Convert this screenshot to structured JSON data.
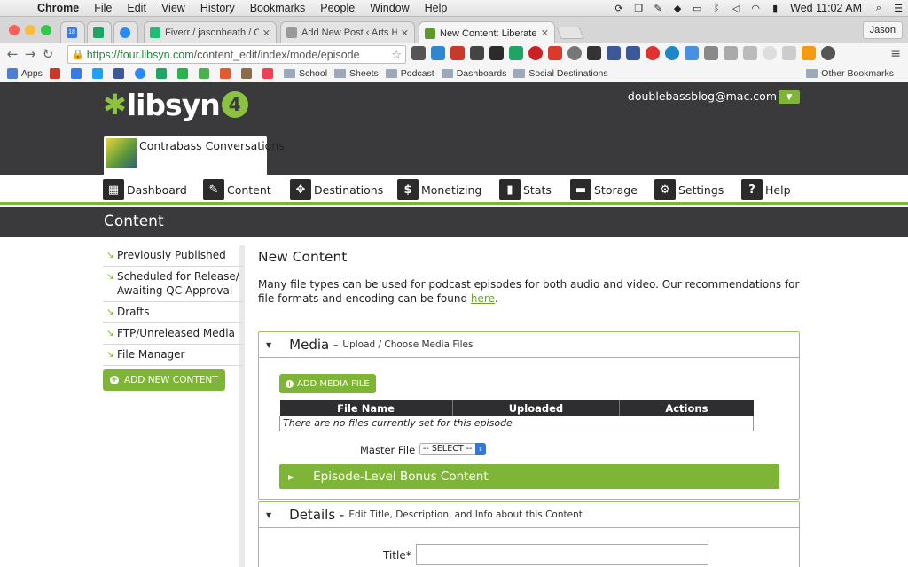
{
  "menubar": {
    "app": "Chrome",
    "items": [
      "File",
      "Edit",
      "View",
      "History",
      "Bookmarks",
      "People",
      "Window",
      "Help"
    ],
    "clock": "Wed 11:02 AM"
  },
  "tabs": [
    {
      "title": "18",
      "color": "#3b7be0"
    },
    {
      "title": "",
      "color": "#1fa463"
    },
    {
      "title": "",
      "color": "#2b89ff"
    },
    {
      "title": "Fiverr / jasonheath / Conve",
      "color": "#1dbf73"
    },
    {
      "title": "Add New Post ‹ Arts Hacki",
      "color": "#9a9a9a"
    },
    {
      "title": "New Content: Liberated Sy",
      "color": "#5b9a2a"
    }
  ],
  "profile": "Jason",
  "url": {
    "scheme": "https://",
    "host": "four.libsyn.com",
    "path": "/content_edit/index/mode/episode"
  },
  "bookmarks": {
    "apps": "Apps",
    "folders": [
      "School",
      "Sheets",
      "Podcast",
      "Dashboards",
      "Social Destinations"
    ],
    "other": "Other Bookmarks"
  },
  "header": {
    "logo_text": "libsyn",
    "logo_version": "4",
    "user_email": "doublebassblog@mac.com",
    "show_name": "Contrabass Conversations"
  },
  "nav": {
    "dashboard": "Dashboard",
    "content": "Content",
    "destinations": "Destinations",
    "monetizing": "Monetizing",
    "stats": "Stats",
    "storage": "Storage",
    "settings": "Settings",
    "help": "Help"
  },
  "section_title": "Content",
  "sidebar": {
    "items": [
      "Previously Published",
      "Scheduled for Release/ Awaiting QC Approval",
      "Drafts",
      "FTP/Unreleased Media",
      "File Manager"
    ],
    "add_button": "ADD NEW CONTENT"
  },
  "main": {
    "heading": "New Content",
    "intro": "Many file types can be used for podcast episodes for both audio and video. Our recommendations for file formats and encoding can be found ",
    "intro_link": "here",
    "intro_end": "."
  },
  "media_panel": {
    "title": "Media -",
    "subtitle": "Upload / Choose Media Files",
    "add_button": "ADD MEDIA FILE",
    "columns": [
      "File Name",
      "Uploaded",
      "Actions"
    ],
    "empty_text": "There are no files currently set for this episode",
    "master_label": "Master File",
    "master_select": "-- SELECT --",
    "bonus_title": "Episode-Level Bonus Content"
  },
  "details_panel": {
    "title": "Details -",
    "subtitle": "Edit Title, Description, and Info about this Content",
    "title_label": "Title*",
    "title_value": ""
  },
  "colors": {
    "brand_green": "#7fb537",
    "header_dark": "#3a3a3c"
  }
}
